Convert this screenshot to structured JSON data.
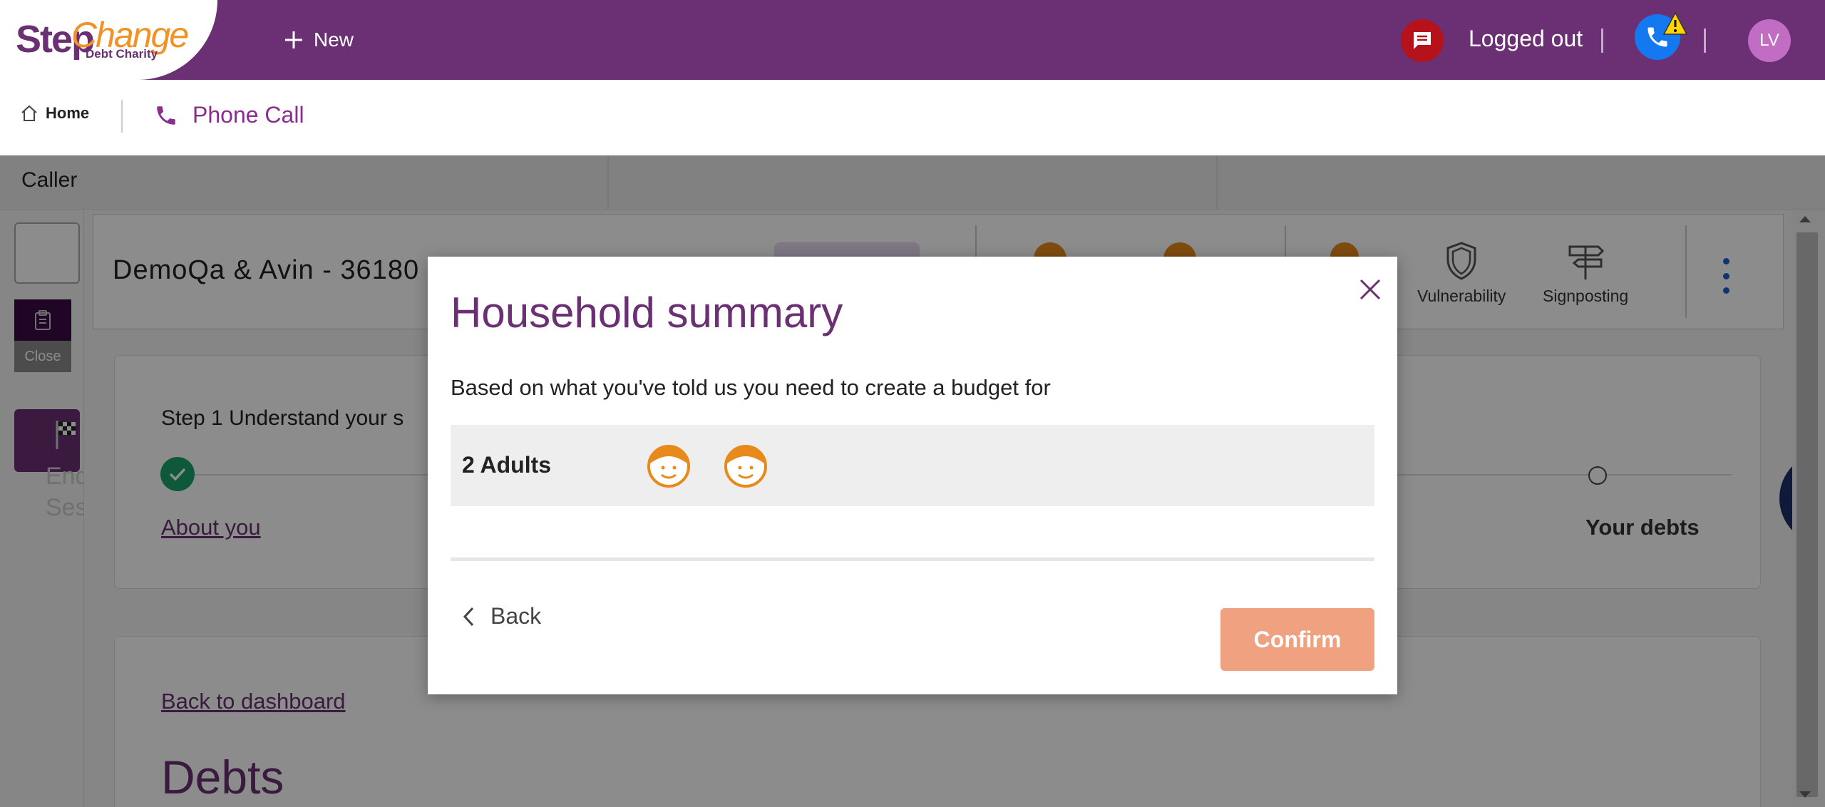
{
  "header": {
    "logo_step": "Step",
    "logo_change": "Change",
    "logo_sub": "Debt Charity",
    "new_label": "New",
    "status_text": "Logged out",
    "avatar_initials": "LV"
  },
  "subheader": {
    "home_label": "Home",
    "phone_call_label": "Phone Call"
  },
  "caller_bar": {
    "label": "Caller"
  },
  "left_rail": {
    "close_label": "Close",
    "end_label": "End Session"
  },
  "customer": {
    "name": "DemoQa & Avin - 36180"
  },
  "header_actions": {
    "vulnerability_label": "Vulnerability",
    "signposting_label": "Signposting"
  },
  "steps": {
    "step_text": "Step  1  Understand your s",
    "about_you": "About you",
    "your_debts": "Your debts"
  },
  "debts": {
    "back_link": "Back to dashboard",
    "title": "Debts"
  },
  "modal": {
    "title": "Household summary",
    "description": "Based on what you've told us you need to create a budget for",
    "household_label": "2 Adults",
    "adult_count": 2,
    "back_label": "Back",
    "confirm_label": "Confirm"
  },
  "colors": {
    "brand_purple": "#6b3073",
    "brand_orange": "#f39224",
    "confirm_disabled": "#f0a180",
    "success_green": "#19a26a"
  }
}
